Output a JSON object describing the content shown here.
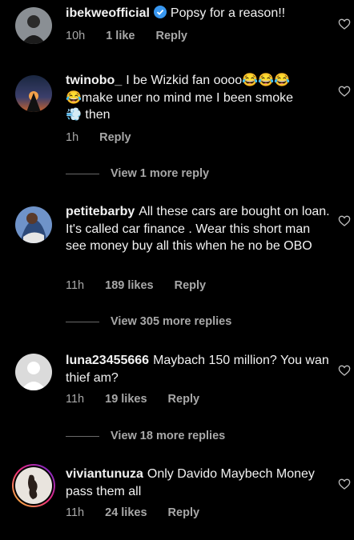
{
  "comments": [
    {
      "username": "ibekweofficial",
      "verified": true,
      "text": "Popsy for a reason!!",
      "time": "10h",
      "likes": "1 like",
      "reply": "Reply"
    },
    {
      "username": "twinobo_",
      "text_line1": "I be Wizkid fan oooo😂😂😂",
      "text_line2": "😂make uner no mind me I been smoke",
      "text_line3": "💨 then",
      "time": "1h",
      "reply": "Reply",
      "more_replies": "View 1 more reply"
    },
    {
      "username": "petitebarby",
      "text": "All these cars are bought on loan. It's called car finance . Wear this short man see money buy all this when he no be OBO",
      "time": "11h",
      "likes": "189 likes",
      "reply": "Reply",
      "more_replies": "View 305 more replies"
    },
    {
      "username": "luna23455666",
      "text": "Maybach 150 million? You wan thief am?",
      "time": "11h",
      "likes": "19 likes",
      "reply": "Reply",
      "more_replies": "View 18 more replies"
    },
    {
      "username": "viviantunuza",
      "text": "Only Davido Maybech Money pass them all",
      "time": "11h",
      "likes": "24 likes",
      "reply": "Reply"
    }
  ],
  "colors": {
    "background": "#000000",
    "text": "#f2f2f2",
    "secondary": "#a8a8a8",
    "verified": "#3897f0"
  },
  "icons": {
    "like": "heart-outline-icon",
    "verified": "verified-badge-icon"
  }
}
